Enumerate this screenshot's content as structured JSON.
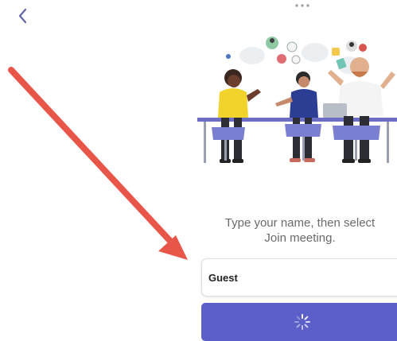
{
  "navigation": {
    "back_icon": "chevron-left-icon",
    "more_icon": "more-horizontal-icon"
  },
  "join": {
    "prompt": "Type your name, then select\nJoin meeting.",
    "name_value": "Guest",
    "join_button_state": "loading-spinner"
  },
  "annotation": {
    "arrow_color": "#e8564a"
  },
  "colors": {
    "accent": "#5b5fc7",
    "back_icon": "#6264a7"
  }
}
